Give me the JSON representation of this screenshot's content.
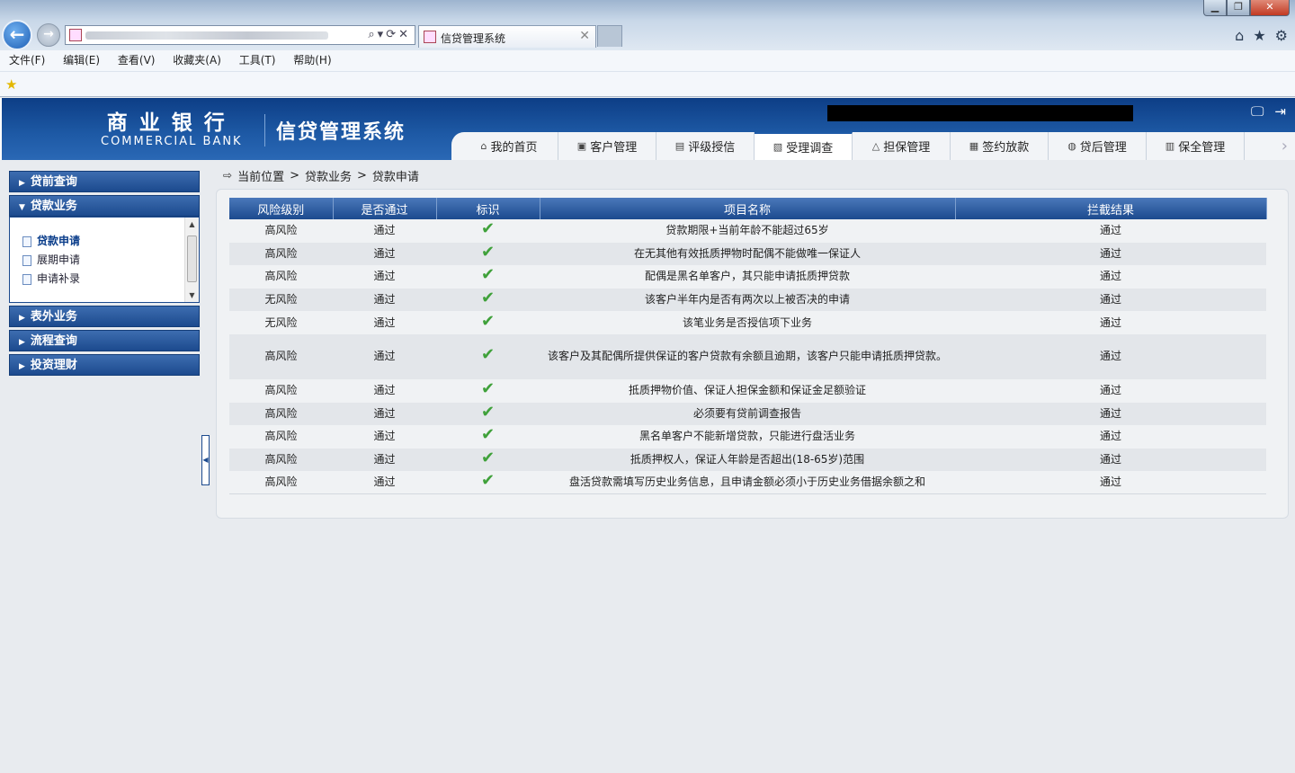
{
  "browser": {
    "tab_title": "信贷管理系统",
    "menu": [
      "文件(F)",
      "编辑(E)",
      "查看(V)",
      "收藏夹(A)",
      "工具(T)",
      "帮助(H)"
    ]
  },
  "header": {
    "logo_cn": "商业银行",
    "logo_en": "COMMERCIAL BANK",
    "system_title": "信贷管理系统"
  },
  "topnav": [
    {
      "label": "我的首页",
      "icon": "home-icon"
    },
    {
      "label": "客户管理",
      "icon": "customer-icon"
    },
    {
      "label": "评级授信",
      "icon": "rating-icon"
    },
    {
      "label": "受理调查",
      "icon": "survey-icon",
      "active": true
    },
    {
      "label": "担保管理",
      "icon": "guarantee-icon"
    },
    {
      "label": "签约放款",
      "icon": "contract-icon"
    },
    {
      "label": "贷后管理",
      "icon": "postloan-icon"
    },
    {
      "label": "保全管理",
      "icon": "preservation-icon"
    }
  ],
  "sidebar": {
    "groups": [
      {
        "label": "贷前查询",
        "expanded": false
      },
      {
        "label": "贷款业务",
        "expanded": true,
        "items": [
          "贷款申请",
          "展期申请",
          "申请补录"
        ],
        "active_item": "贷款申请"
      },
      {
        "label": "表外业务",
        "expanded": false
      },
      {
        "label": "流程查询",
        "expanded": false
      },
      {
        "label": "投资理财",
        "expanded": false
      }
    ]
  },
  "breadcrumb": {
    "prefix": "当前位置",
    "sep": ">",
    "level1": "贷款业务",
    "level2": "贷款申请"
  },
  "table": {
    "headers": [
      "风险级别",
      "是否通过",
      "标识",
      "项目名称",
      "拦截结果"
    ],
    "rows": [
      {
        "risk": "高风险",
        "passed": "通过",
        "flag": "✔",
        "item": "贷款期限+当前年龄不能超过65岁",
        "result": "通过"
      },
      {
        "risk": "高风险",
        "passed": "通过",
        "flag": "✔",
        "item": "在无其他有效抵质押物时配偶不能做唯一保证人",
        "result": "通过"
      },
      {
        "risk": "高风险",
        "passed": "通过",
        "flag": "✔",
        "item": "配偶是黑名单客户，其只能申请抵质押贷款",
        "result": "通过"
      },
      {
        "risk": "无风险",
        "passed": "通过",
        "flag": "✔",
        "item": "该客户半年内是否有两次以上被否决的申请",
        "result": "通过"
      },
      {
        "risk": "无风险",
        "passed": "通过",
        "flag": "✔",
        "item": "该笔业务是否授信项下业务",
        "result": "通过"
      },
      {
        "risk": "高风险",
        "passed": "通过",
        "flag": "✔",
        "item": "该客户及其配偶所提供保证的客户贷款有余额且逾期，该客户只能申请抵质押贷款。",
        "result": "通过",
        "tall": true
      },
      {
        "risk": "高风险",
        "passed": "通过",
        "flag": "✔",
        "item": "抵质押物价值、保证人担保金额和保证金足额验证",
        "result": "通过"
      },
      {
        "risk": "高风险",
        "passed": "通过",
        "flag": "✔",
        "item": "必须要有贷前调查报告",
        "result": "通过"
      },
      {
        "risk": "高风险",
        "passed": "通过",
        "flag": "✔",
        "item": "黑名单客户不能新增贷款，只能进行盘活业务",
        "result": "通过"
      },
      {
        "risk": "高风险",
        "passed": "通过",
        "flag": "✔",
        "item": "抵质押权人，保证人年龄是否超出(18-65岁)范围",
        "result": "通过"
      },
      {
        "risk": "高风险",
        "passed": "通过",
        "flag": "✔",
        "item": "盘活贷款需填写历史业务信息，且申请金额必须小于历史业务借据余额之和",
        "result": "通过"
      }
    ]
  },
  "colors": {
    "header_blue": "#1e5aa6",
    "check_green": "#3fa13a"
  }
}
